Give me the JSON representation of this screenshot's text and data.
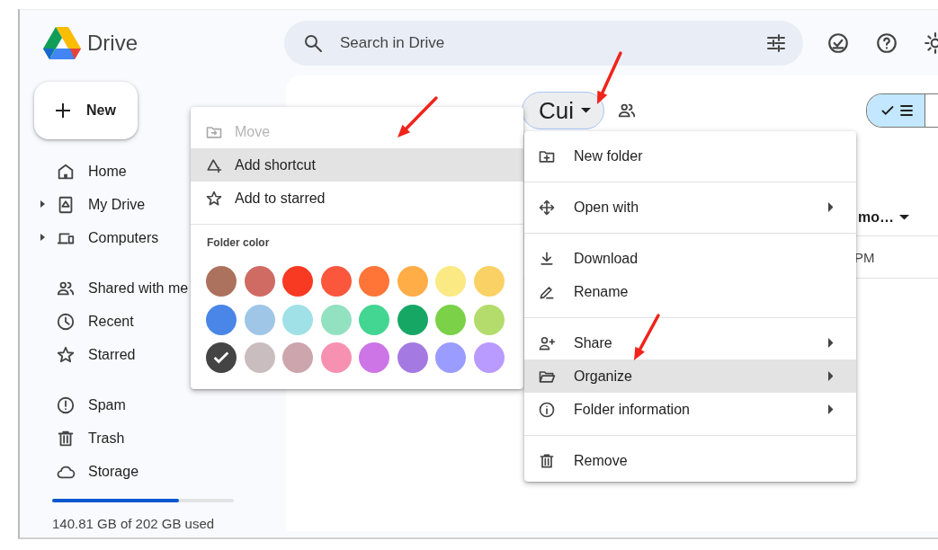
{
  "app": {
    "name": "Drive"
  },
  "search": {
    "placeholder": "Search in Drive"
  },
  "new_button": {
    "label": "New"
  },
  "sidebar": {
    "groups": [
      {
        "items": [
          {
            "label": "Home",
            "kind": "plain"
          },
          {
            "label": "My Drive",
            "kind": "tree"
          },
          {
            "label": "Computers",
            "kind": "tree"
          }
        ]
      },
      {
        "items": [
          {
            "label": "Shared with me",
            "kind": "plain"
          },
          {
            "label": "Recent",
            "kind": "plain"
          },
          {
            "label": "Starred",
            "kind": "plain"
          }
        ]
      },
      {
        "items": [
          {
            "label": "Spam",
            "kind": "plain"
          },
          {
            "label": "Trash",
            "kind": "plain"
          },
          {
            "label": "Storage",
            "kind": "plain"
          }
        ]
      }
    ]
  },
  "storage": {
    "level": 0.697,
    "text": "140.81 GB of 202 GB used"
  },
  "breadcrumb": {
    "label": "Cui"
  },
  "view_toggle": {
    "segments": [
      {
        "selected": true
      },
      {
        "selected": false
      }
    ]
  },
  "table": {
    "columns": [
      {
        "label": "mo…"
      }
    ],
    "rows": [
      {
        "cells": [
          "PM"
        ]
      }
    ]
  },
  "folder_menu": {
    "items": [
      {
        "label": "Move",
        "disabled": true,
        "highlighted": false
      },
      {
        "label": "Add shortcut",
        "disabled": false,
        "highlighted": true
      },
      {
        "label": "Add to starred",
        "disabled": false,
        "highlighted": false
      }
    ],
    "color_title": "Folder color",
    "colors": [
      {
        "color": "#ac725e",
        "selected": false
      },
      {
        "color": "#d06b64",
        "selected": false
      },
      {
        "color": "#f83a22",
        "selected": false
      },
      {
        "color": "#fa573c",
        "selected": false
      },
      {
        "color": "#ff7537",
        "selected": false
      },
      {
        "color": "#ffad46",
        "selected": false
      },
      {
        "color": "#fbe983",
        "selected": false
      },
      {
        "color": "#fad165",
        "selected": false
      },
      {
        "color": "#4986e7",
        "selected": false
      },
      {
        "color": "#9fc6e7",
        "selected": false
      },
      {
        "color": "#9fe1e7",
        "selected": false
      },
      {
        "color": "#92e1c0",
        "selected": false
      },
      {
        "color": "#42d692",
        "selected": false
      },
      {
        "color": "#16a765",
        "selected": false
      },
      {
        "color": "#7bd148",
        "selected": false
      },
      {
        "color": "#b3dc6c",
        "selected": false
      },
      {
        "color": "#444444",
        "selected": true
      },
      {
        "color": "#cabdbf",
        "selected": false
      },
      {
        "color": "#cca6ac",
        "selected": false
      },
      {
        "color": "#f691b2",
        "selected": false
      },
      {
        "color": "#cd74e6",
        "selected": false
      },
      {
        "color": "#a47ae2",
        "selected": false
      },
      {
        "color": "#9a9cff",
        "selected": false
      },
      {
        "color": "#b99aff",
        "selected": false
      }
    ]
  },
  "actions_menu": {
    "groups": [
      {
        "items": [
          {
            "label": "New folder",
            "submenu": false,
            "highlighted": false
          }
        ]
      },
      {
        "items": [
          {
            "label": "Open with",
            "submenu": true,
            "highlighted": false
          }
        ]
      },
      {
        "items": [
          {
            "label": "Download",
            "submenu": false,
            "highlighted": false
          },
          {
            "label": "Rename",
            "submenu": false,
            "highlighted": false
          }
        ]
      },
      {
        "items": [
          {
            "label": "Share",
            "submenu": true,
            "highlighted": false
          },
          {
            "label": "Organize",
            "submenu": true,
            "highlighted": true
          },
          {
            "label": "Folder information",
            "submenu": true,
            "highlighted": false
          }
        ]
      },
      {
        "items": [
          {
            "label": "Remove",
            "submenu": false,
            "highlighted": false
          }
        ]
      }
    ]
  }
}
